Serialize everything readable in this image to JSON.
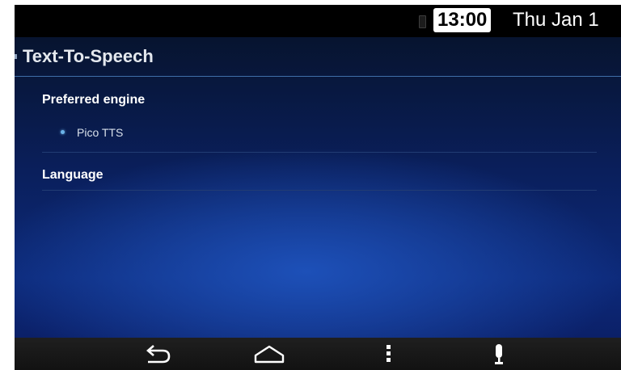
{
  "status_bar": {
    "time": "13:00",
    "date": "Thu Jan 1",
    "battery_icon": "battery-icon"
  },
  "header": {
    "title": "Text-To-Speech"
  },
  "sections": {
    "preferred_engine": {
      "label": "Preferred engine",
      "options": [
        {
          "label": "Pico TTS",
          "selected": true
        }
      ]
    },
    "language": {
      "label": "Language"
    }
  },
  "nav_bar": {
    "buttons": [
      "back-icon",
      "home-icon",
      "menu-icon",
      "microphone-icon"
    ]
  },
  "colors": {
    "background_top": "#07142f",
    "background_glow": "#1d50b8",
    "accent": "#6bb3e8",
    "divider": "#3f6fa8"
  }
}
